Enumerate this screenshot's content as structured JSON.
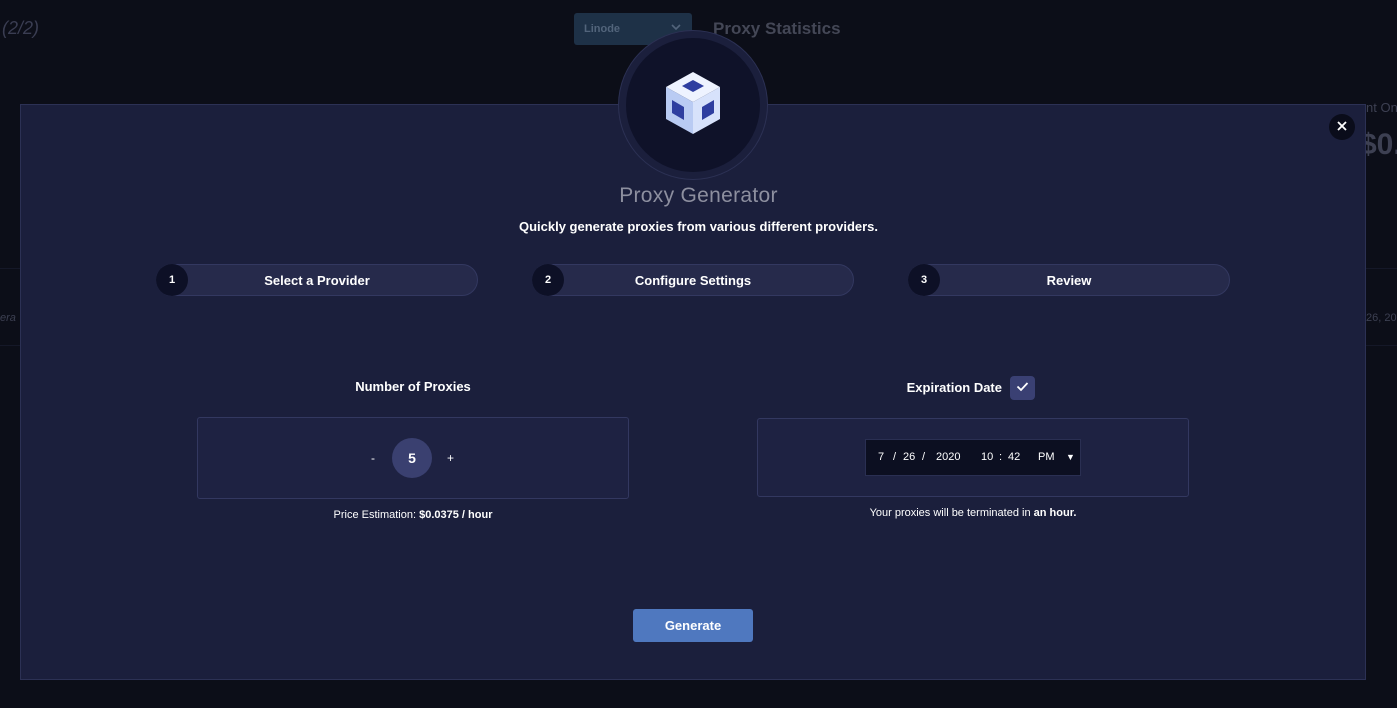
{
  "background": {
    "counter": "(2/2)",
    "provider_select": "Linode",
    "section_title": "Proxy Statistics",
    "right_label_fragment": "nt On",
    "right_value_fragment": "$0.",
    "left_row_fragment": "era",
    "right_row_fragment": "26, 202"
  },
  "modal": {
    "title": "Proxy Generator",
    "subtitle": "Quickly generate proxies from various different providers.",
    "close_icon": "close-icon",
    "logo_icon": "cube-icon",
    "steps": [
      {
        "number": "1",
        "label": "Select a Provider"
      },
      {
        "number": "2",
        "label": "Configure Settings"
      },
      {
        "number": "3",
        "label": "Review"
      }
    ],
    "proxies": {
      "label": "Number of Proxies",
      "minus": "-",
      "value": "5",
      "plus": "+",
      "price_prefix": "Price Estimation:",
      "price_value": "$0.0375 / hour"
    },
    "expiration": {
      "label": "Expiration Date",
      "checked": true,
      "month": "7",
      "day": "26",
      "year": "2020",
      "hour": "10",
      "minute": "42",
      "ampm": "PM",
      "sep_slash": "/",
      "sep_colon": ":",
      "dropdown_icon": "▼",
      "term_prefix": "Your proxies will be terminated in",
      "term_value": "an hour."
    },
    "generate_label": "Generate"
  },
  "colors": {
    "modal_bg": "#1b1f3c",
    "accent_button": "#4f78bf",
    "stepper_circle": "#3a4070"
  }
}
